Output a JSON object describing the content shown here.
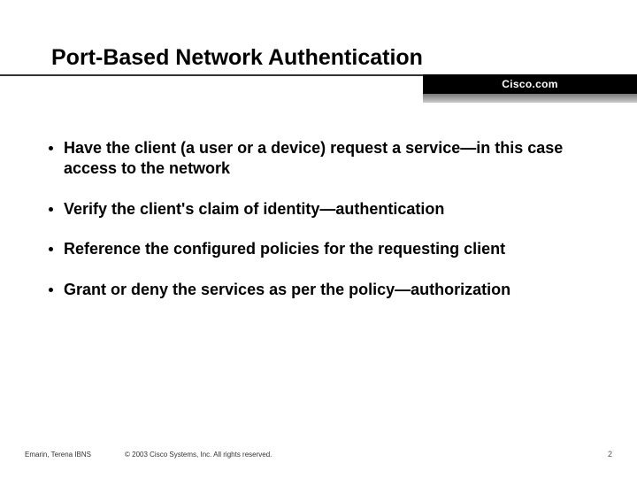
{
  "header": {
    "title": "Port-Based Network Authentication",
    "brand": "Cisco.com"
  },
  "bullets": [
    "Have the client (a user or a device) request a service—in this case access to the network",
    "Verify the client's claim of identity—authentication",
    "Reference the configured policies for the requesting client",
    "Grant or deny the services as per the policy—authorization"
  ],
  "footer": {
    "left1": "Emarin, Terena IBNS",
    "copyright": "© 2003 Cisco Systems, Inc. All rights reserved.",
    "page": "2"
  }
}
